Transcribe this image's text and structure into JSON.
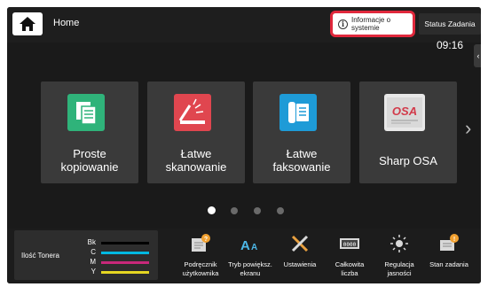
{
  "header": {
    "home_label": "Home",
    "info_label_line1": "Informacje o",
    "info_label_line2": "systemie",
    "status_label": "Status Zadania",
    "clock": "09:16"
  },
  "tiles": [
    {
      "line1": "Proste",
      "line2": "kopiowanie",
      "icon": "copy-icon",
      "color": "#2fb37a"
    },
    {
      "line1": "Łatwe",
      "line2": "skanowanie",
      "icon": "scan-icon",
      "color": "#e0464f"
    },
    {
      "line1": "Łatwe",
      "line2": "faksowanie",
      "icon": "fax-icon",
      "color": "#1e9bd7"
    },
    {
      "line1": "Sharp OSA",
      "line2": "",
      "icon": "sharp-osa-icon",
      "color": "#e8e8e8"
    }
  ],
  "pager": {
    "pages": 4,
    "active": 0
  },
  "toner": {
    "title": "Ilość Tonera",
    "rows": [
      {
        "code": "Bk",
        "color": "#000000"
      },
      {
        "code": "C",
        "color": "#00b8e0"
      },
      {
        "code": "M",
        "color": "#c8287a"
      },
      {
        "code": "Y",
        "color": "#e6d622"
      }
    ]
  },
  "tools": [
    {
      "line1": "Podręcznik",
      "line2": "użytkownika",
      "icon": "manual-icon"
    },
    {
      "line1": "Tryb powiększ.",
      "line2": "ekranu",
      "icon": "zoom-text-icon"
    },
    {
      "line1": "Ustawienia",
      "line2": "",
      "icon": "settings-icon"
    },
    {
      "line1": "Całkowita",
      "line2": "liczba",
      "icon": "counter-icon"
    },
    {
      "line1": "Regulacja",
      "line2": "jasności",
      "icon": "brightness-icon"
    },
    {
      "line1": "Stan zadania",
      "line2": "",
      "icon": "job-status-icon"
    }
  ]
}
